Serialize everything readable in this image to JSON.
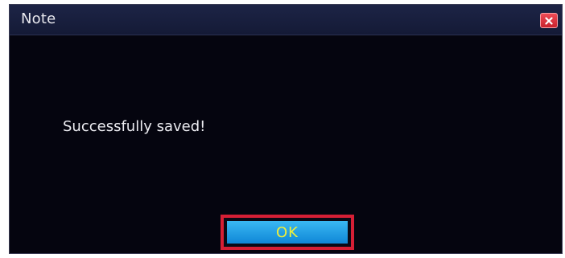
{
  "dialog": {
    "title": "Note",
    "message": "Successfully saved!",
    "ok_label": "OK",
    "close_icon": "close-icon"
  },
  "colors": {
    "dialog_background": "#05050f",
    "titlebar": "#1d2446",
    "close_button": "#e0313c",
    "ok_button": "#1b9be5",
    "ok_text": "#f0ef3a",
    "highlight_border": "#d61f35"
  }
}
